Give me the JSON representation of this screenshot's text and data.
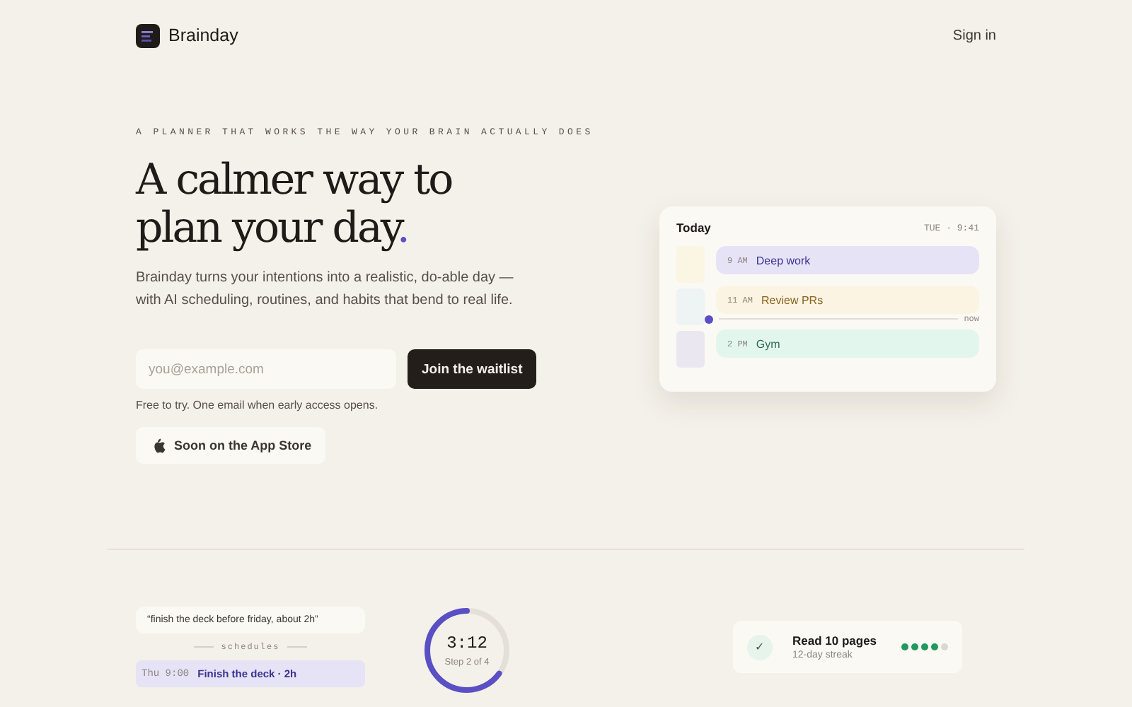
{
  "header": {
    "brand": "Brainday",
    "sign_in": "Sign in"
  },
  "hero": {
    "eyebrow": "A PLANNER THAT WORKS THE WAY YOUR BRAIN ACTUALLY DOES",
    "title_lines": [
      "A calmer way to",
      "plan your day"
    ],
    "title_dot": ".",
    "lead": "Brainday turns your intentions into a realistic, do-able day —",
    "lead_2": "with AI scheduling, routines, and habits that bend to real life.",
    "email": {
      "placeholder": "you@example.com"
    },
    "cta": "Join the waitlist",
    "note": "Free to try. One email when early access opens.",
    "app_store": "Soon on the App Store"
  },
  "calendar": {
    "title": "Today",
    "time": "TUE · 9:41",
    "now_label": "now",
    "events": [
      {
        "time": "9 AM",
        "title": "Deep work",
        "color": "#e6e3f7"
      },
      {
        "time": "11 AM",
        "title": "Review PRs",
        "color": "#fbf4e2"
      },
      {
        "time": "2 PM",
        "title": "Gym",
        "color": "#e3f6ee"
      }
    ]
  },
  "features": {
    "quote": "“finish the deck before friday, about 2h”",
    "divider_label": "schedules",
    "scheduled": {
      "when": "Thu 9:00",
      "task": "Finish the deck · 2h"
    },
    "timer": {
      "time": "3:12",
      "step": "Step 2 of 4"
    },
    "habit": {
      "check": "✓",
      "title": "Read 10 pages",
      "subtitle": "12-day streak",
      "stars": 4
    }
  }
}
